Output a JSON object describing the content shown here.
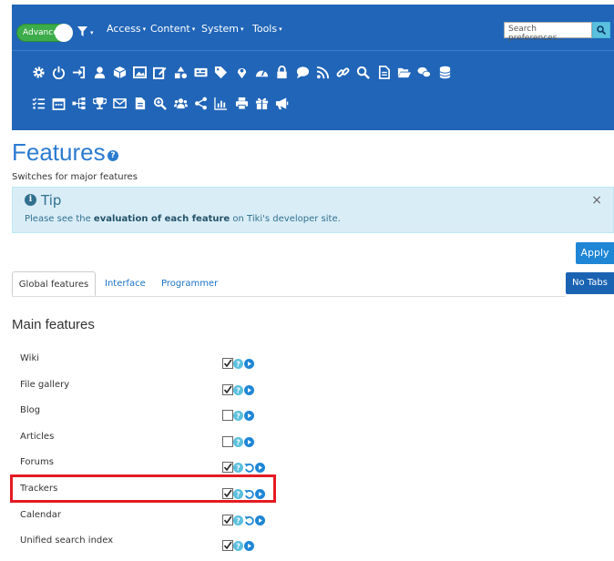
{
  "topbar": {
    "mode_label": "Advanced",
    "menus": [
      "Access",
      "Content",
      "System",
      "Tools"
    ],
    "search_placeholder": "Search preferences...",
    "icons_row1": [
      "gear-icon",
      "power-icon",
      "sign-in-icon",
      "user-icon",
      "cube-icon",
      "image-icon",
      "edit-icon",
      "shapes-icon",
      "keyboard-icon",
      "tag-icon",
      "map-marker-icon",
      "dashboard-icon",
      "lock-icon",
      "comment-icon",
      "rss-icon",
      "link-icon",
      "search-icon",
      "file-text-icon",
      "folder-open-icon",
      "comments-icon",
      "database-icon"
    ],
    "icons_row2": [
      "checklist-icon",
      "calendar-icon",
      "sitemap-icon",
      "trophy-icon",
      "envelope-icon",
      "file-icon",
      "zoom-in-icon",
      "users-icon",
      "share-icon",
      "bar-chart-icon",
      "print-icon",
      "gift-icon",
      "bullhorn-icon"
    ]
  },
  "page": {
    "title": "Features",
    "subtitle": "Switches for major features"
  },
  "tip": {
    "title": "Tip",
    "text_before": "Please see the ",
    "text_bold": "evaluation of each feature",
    "text_after": " on Tiki's developer site.",
    "close": "×"
  },
  "apply_label": "Apply",
  "notabs_label": "No Tabs",
  "tabs": [
    "Global features",
    "Interface",
    "Programmer"
  ],
  "section_title": "Main features",
  "features": [
    {
      "label": "Wiki",
      "checked": true,
      "reset": false
    },
    {
      "label": "File gallery",
      "checked": true,
      "reset": false
    },
    {
      "label": "Blog",
      "checked": false,
      "reset": false
    },
    {
      "label": "Articles",
      "checked": false,
      "reset": false
    },
    {
      "label": "Forums",
      "checked": true,
      "reset": true
    },
    {
      "label": "Trackers",
      "checked": true,
      "reset": true
    },
    {
      "label": "Calendar",
      "checked": true,
      "reset": true
    },
    {
      "label": "Unified search index",
      "checked": true,
      "reset": false
    }
  ]
}
